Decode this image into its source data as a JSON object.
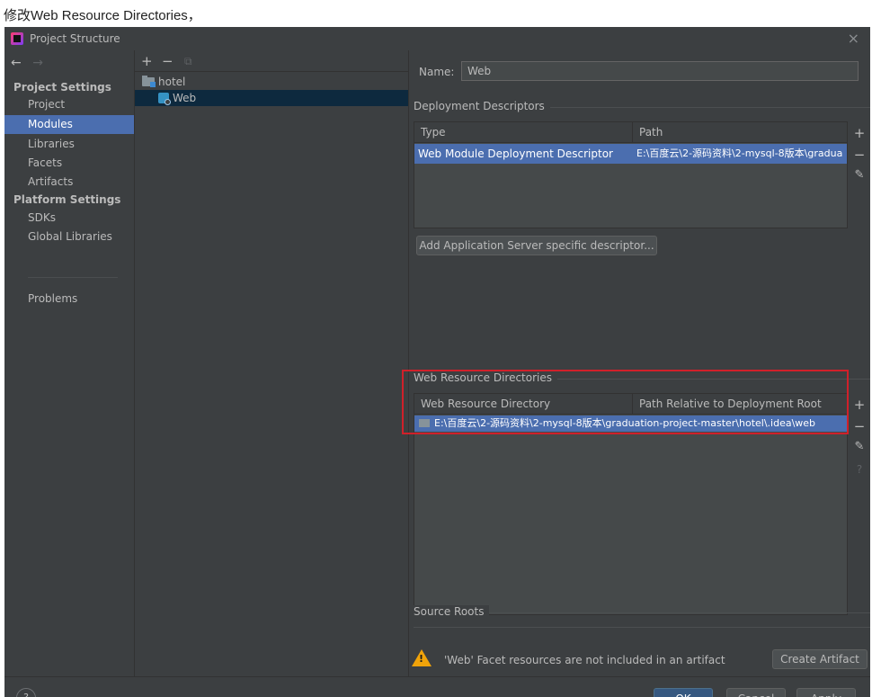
{
  "caption": "修改Web Resource Directories，",
  "window": {
    "title": "Project Structure",
    "close": "×"
  },
  "nav": {
    "back_arrow": "←",
    "forward_arrow": "→",
    "project_settings_heading": "Project Settings",
    "project_items": [
      "Project",
      "Modules",
      "Libraries",
      "Facets",
      "Artifacts"
    ],
    "selected": "Modules",
    "platform_settings_heading": "Platform Settings",
    "platform_items": [
      "SDKs",
      "Global Libraries"
    ],
    "problems": "Problems"
  },
  "tree": {
    "tools": {
      "add": "+",
      "remove": "−",
      "copy": "⧉"
    },
    "nodes": [
      "hotel",
      "Web"
    ],
    "selected": "Web"
  },
  "facet": {
    "name_label": "Name:",
    "name_value": "Web",
    "deployment": {
      "title": "Deployment Descriptors",
      "columns": [
        "Type",
        "Path"
      ],
      "rows": [
        {
          "type": "Web Module Deployment Descriptor",
          "path": "E:\\百度云\\2-源码资料\\2-mysql-8版本\\gradua"
        }
      ],
      "add_specific_button": "Add Application Server specific descriptor..."
    },
    "resources": {
      "title": "Web Resource Directories",
      "columns": [
        "Web Resource Directory",
        "Path Relative to Deployment Root"
      ],
      "rows": [
        {
          "dir": "E:\\百度云\\2-源码资料\\2-mysql-8版本\\graduation-project-master\\hotel\\.idea\\web",
          "relative": "/"
        }
      ]
    },
    "side_tools": {
      "add": "+",
      "remove": "−",
      "edit": "✎",
      "help": "?"
    },
    "source_roots": {
      "title": "Source Roots"
    },
    "warning": "'Web' Facet resources are not included in an artifact",
    "create_artifact_button": "Create Artifact"
  },
  "footer": {
    "help": "?",
    "ok": "OK",
    "cancel": "Cancel",
    "apply": "Apply"
  },
  "colors": {
    "accent": "#4b6eaf",
    "tree_selection": "#0d293e",
    "highlight": "#d0202a",
    "warning": "#f0a30a"
  }
}
